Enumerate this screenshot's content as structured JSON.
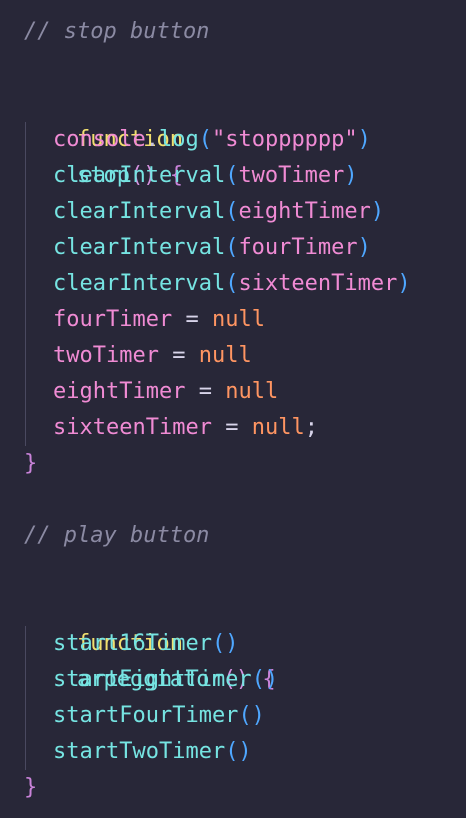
{
  "colors": {
    "background": "#282738",
    "keyword": "#f1df6f",
    "function": "#76e4e2",
    "variable": "#f08bd4",
    "null": "#ff9562",
    "comment": "#8b8aa3"
  },
  "code": {
    "comment_stop": "// stop button",
    "stop_kw": "function",
    "stop_name": "stop",
    "stop_open": "() {",
    "stop_lines": [
      {
        "fn": "console",
        "dot": ".",
        "call": "log",
        "open": "(",
        "arg": "\"stopppppp\"",
        "close": ")"
      },
      {
        "call": "clearInterval",
        "open": "(",
        "arg": "twoTimer",
        "close": ")"
      },
      {
        "call": "clearInterval",
        "open": "(",
        "arg": "eightTimer",
        "close": ")"
      },
      {
        "call": "clearInterval",
        "open": "(",
        "arg": "fourTimer",
        "close": ")"
      },
      {
        "call": "clearInterval",
        "open": "(",
        "arg": "sixteenTimer",
        "close": ")"
      }
    ],
    "assignments": [
      {
        "var": "fourTimer",
        "op": " = ",
        "val": "null",
        "end": ""
      },
      {
        "var": "twoTimer",
        "op": " = ",
        "val": "null",
        "end": ""
      },
      {
        "var": "eightTimer",
        "op": " = ",
        "val": "null",
        "end": ""
      },
      {
        "var": "sixteenTimer",
        "op": " = ",
        "val": "null",
        "end": ";"
      }
    ],
    "close_brace": "}",
    "comment_play": "// play button",
    "play_kw": "function",
    "play_name": "arpeggiator",
    "play_open": "() {",
    "play_calls": [
      {
        "call": "start16Timer",
        "parens": "()"
      },
      {
        "call": "startEightTimer",
        "parens": "()"
      },
      {
        "call": "startFourTimer",
        "parens": "()"
      },
      {
        "call": "startTwoTimer",
        "parens": "()"
      }
    ]
  }
}
